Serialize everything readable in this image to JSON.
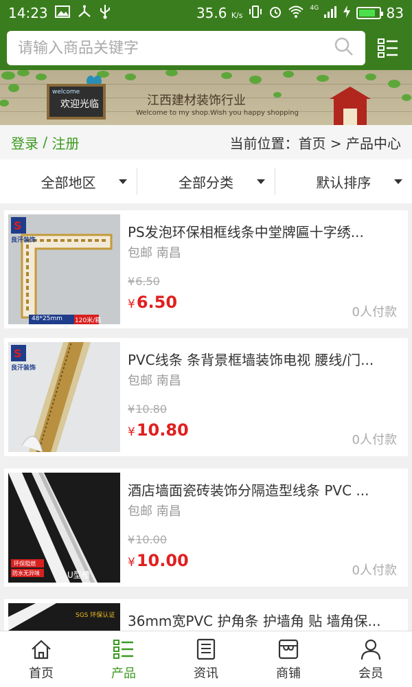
{
  "status": {
    "time": "14:23",
    "speed": "35.6",
    "speed_unit": "K/s",
    "network": "4G",
    "battery": "83",
    "battery_level": 0.83
  },
  "search": {
    "placeholder": "请输入商品关键字"
  },
  "banner": {
    "board_text": "欢迎光临",
    "board_welcome": "welcome",
    "title": "江西建材装饰行业",
    "subtitle": "Welcome to my shop.Wish you happy shopping"
  },
  "login_bar": {
    "login": "登录",
    "separator": " / ",
    "register": "注册",
    "location_label": "当前位置：",
    "home": "首页",
    "arrow": " > ",
    "current": "产品中心"
  },
  "filters": [
    {
      "label": "全部地区"
    },
    {
      "label": "全部分类"
    },
    {
      "label": "默认排序"
    }
  ],
  "currency": "¥",
  "products": [
    {
      "title": "PS发泡环保相框线条中堂牌匾十字绣...",
      "location": "包邮 南昌",
      "old_price": "6.50",
      "price": "6.50",
      "sales": "0人付款",
      "brand": "良汗装饰",
      "badge": "48*25mm",
      "badge2": "120米/箱"
    },
    {
      "title": "PVC线条 条背景框墙装饰电视 腰线/门...",
      "location": "包邮 南昌",
      "old_price": "10.80",
      "price": "10.80",
      "sales": "0人付款",
      "brand": "良汗装饰"
    },
    {
      "title": "酒店墙面瓷砖装饰分隔造型线条 PVC ...",
      "location": "包邮 南昌",
      "old_price": "10.00",
      "price": "10.00",
      "sales": "0人付款",
      "tag1": "环保阻燃",
      "tag2": "防水无异味",
      "label": "U型槽"
    },
    {
      "title": "36mm宽PVC 护角条 护墙角 贴 墙角保...",
      "label": "SGS 环保认证"
    }
  ],
  "tabs": [
    {
      "label": "首页",
      "icon": "home-icon"
    },
    {
      "label": "产品",
      "icon": "product-list-icon"
    },
    {
      "label": "资讯",
      "icon": "news-icon"
    },
    {
      "label": "商铺",
      "icon": "store-icon"
    },
    {
      "label": "会员",
      "icon": "member-icon"
    }
  ],
  "colors": {
    "primary_green": "#3a7d1e",
    "link_green": "#3a9a1e",
    "price_red": "#e02020"
  }
}
